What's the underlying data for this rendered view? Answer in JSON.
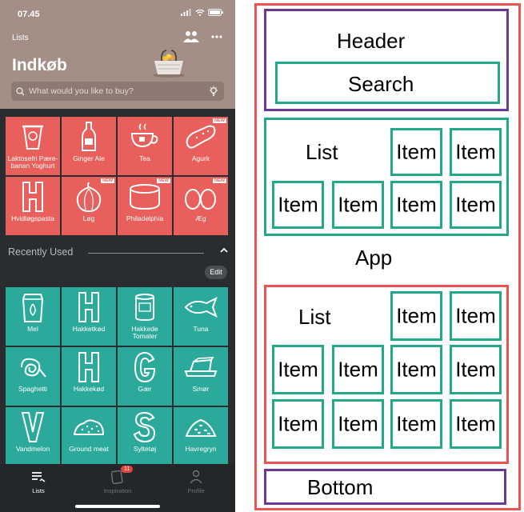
{
  "phone": {
    "status": {
      "time": "07.45"
    },
    "header": {
      "lists_label": "Lists",
      "title": "Indkøb",
      "search_placeholder": "What would you like to buy?"
    },
    "list_items": [
      {
        "label": "Laktosefri Pære-banan Yoghurt",
        "icon": "yoghurt-icon",
        "new": false
      },
      {
        "label": "Ginger Ale",
        "icon": "bottle-icon",
        "new": false
      },
      {
        "label": "Tea",
        "icon": "teacup-icon",
        "new": false
      },
      {
        "label": "Agurk",
        "icon": "cucumber-icon",
        "new": true
      },
      {
        "label": "Hvidløgspasta",
        "icon": "letter-h-icon",
        "new": false
      },
      {
        "label": "Løg",
        "icon": "onion-icon",
        "new": true
      },
      {
        "label": "Philadelphia",
        "icon": "tub-icon",
        "new": true
      },
      {
        "label": "Æg",
        "icon": "eggs-icon",
        "new": true
      }
    ],
    "new_badge": "NEW",
    "recently_used": {
      "title": "Recently Used",
      "edit_label": "Edit",
      "items": [
        {
          "label": "Mel",
          "icon": "flour-bag-icon"
        },
        {
          "label": "Hakketkød",
          "icon": "letter-h-icon"
        },
        {
          "label": "Hakkede Tomater",
          "icon": "tin-can-icon"
        },
        {
          "label": "Tuna",
          "icon": "fish-icon"
        },
        {
          "label": "Spaghetti",
          "icon": "spaghetti-icon"
        },
        {
          "label": "Hakkekød",
          "icon": "letter-h-icon"
        },
        {
          "label": "Gær",
          "icon": "letter-g-icon"
        },
        {
          "label": "Smør",
          "icon": "butter-icon"
        },
        {
          "label": "Vandmelon",
          "icon": "letter-v-icon"
        },
        {
          "label": "Ground meat",
          "icon": "ground-meat-icon"
        },
        {
          "label": "Syltetøj",
          "icon": "letter-s-icon"
        },
        {
          "label": "Havregryn",
          "icon": "oats-icon"
        }
      ]
    },
    "bottom_nav": [
      {
        "label": "Lists",
        "icon": "lists-icon",
        "active": true
      },
      {
        "label": "Inspiration",
        "icon": "inspiration-icon",
        "active": false,
        "badge": "11"
      },
      {
        "label": "Profile",
        "icon": "profile-icon",
        "active": false
      }
    ],
    "colors": {
      "header": "#a48f86",
      "list_tile": "#e85f5c",
      "recent_tile": "#2ba99b",
      "background": "#2a2d30"
    }
  },
  "diagram": {
    "header": "Header",
    "search": "Search",
    "list": "List",
    "item": "Item",
    "app": "App",
    "bottom": "Bottom",
    "colors": {
      "app": "#e8524f",
      "header": "#6a3a96",
      "component": "#23a98a"
    }
  }
}
